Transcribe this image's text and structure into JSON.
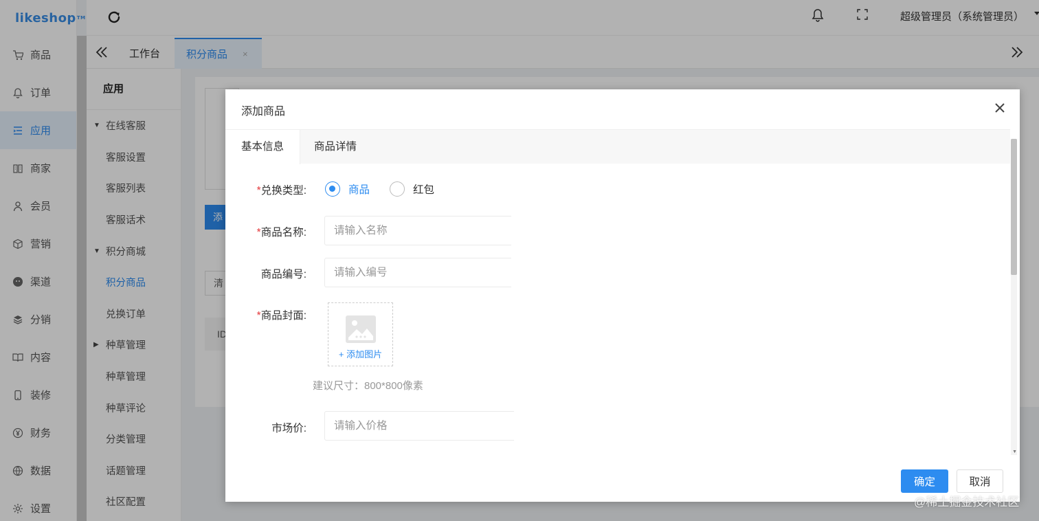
{
  "app": {
    "logo": "likeshop",
    "logo_tm": "TM"
  },
  "nav": [
    {
      "label": "商品",
      "icon": "cart-icon"
    },
    {
      "label": "订单",
      "icon": "bell-icon"
    },
    {
      "label": "应用",
      "icon": "list-icon",
      "active": true
    },
    {
      "label": "商家",
      "icon": "store-icon"
    },
    {
      "label": "会员",
      "icon": "user-icon"
    },
    {
      "label": "营销",
      "icon": "cube-icon"
    },
    {
      "label": "渠道",
      "icon": "wechat-icon"
    },
    {
      "label": "分销",
      "icon": "layers-icon"
    },
    {
      "label": "内容",
      "icon": "book-icon"
    },
    {
      "label": "装修",
      "icon": "mobile-icon"
    },
    {
      "label": "财务",
      "icon": "yen-icon"
    },
    {
      "label": "数据",
      "icon": "globe-icon"
    },
    {
      "label": "设置",
      "icon": "gear-icon"
    }
  ],
  "header": {
    "user": "超级管理员（系统管理员）"
  },
  "tabs": {
    "home": "工作台",
    "current": "积分商品",
    "close": "×"
  },
  "submenu": {
    "title": "应用",
    "groups": [
      {
        "label": "在线客服",
        "items": [
          "客服设置",
          "客服列表",
          "客服话术"
        ],
        "expanded": true
      },
      {
        "label": "积分商城",
        "items": [
          "积分商品",
          "兑换订单"
        ],
        "expanded": true
      },
      {
        "label": "种草管理",
        "items": [
          "种草管理",
          "种草评论",
          "分类管理",
          "话题管理",
          "社区配置"
        ],
        "expanded": false
      }
    ]
  },
  "background": {
    "add_button": "添",
    "select": "清",
    "table_header": "ID"
  },
  "dialog": {
    "title": "添加商品",
    "tabs": [
      "基本信息",
      "商品详情"
    ],
    "exchange_type": {
      "label": "兑换类型:",
      "options": [
        "商品",
        "红包"
      ],
      "selected": "商品"
    },
    "name": {
      "label": "商品名称:",
      "placeholder": "请输入名称"
    },
    "code": {
      "label": "商品编号:",
      "placeholder": "请输入编号"
    },
    "cover": {
      "label": "商品封面:",
      "add_label": "+ 添加图片",
      "hint": "建议尺寸：800*800像素"
    },
    "market_price": {
      "label": "市场价:",
      "placeholder": "请输入价格"
    },
    "confirm": "确定",
    "cancel": "取消"
  },
  "watermark": "@稀土掘金技术社区",
  "colors": {
    "accent": "#2d8cf0",
    "required": "#e4393c"
  }
}
